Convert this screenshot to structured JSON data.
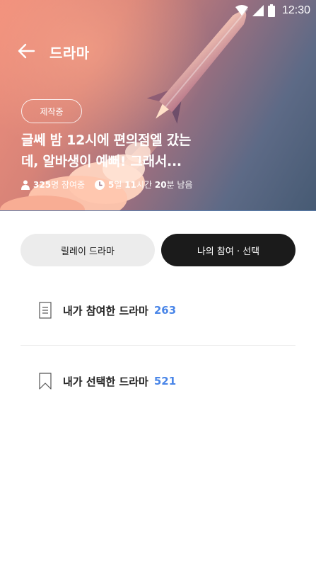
{
  "status_bar": {
    "time": "12:30",
    "icons": [
      "wifi-icon",
      "cell-signal-icon",
      "battery-icon"
    ]
  },
  "header": {
    "back_icon": "arrow-left-icon",
    "title": "드라마"
  },
  "hero": {
    "badge": "제작중",
    "title_line1": "글쎄 밤 12시에 편의점엘 갔는",
    "title_line2": "데, 알바생이 예뻐! 그래서...",
    "participants": {
      "icon": "person-icon",
      "count": "325",
      "text": "명 참여중"
    },
    "time_left": {
      "icon": "clock-icon",
      "days": "5",
      "days_unit": "일 ",
      "hours": "11",
      "hours_unit": "시간 ",
      "minutes": "20",
      "minutes_unit": "분 남음"
    }
  },
  "tabs": [
    {
      "label": "릴레이 드라마",
      "active": false
    },
    {
      "label": "나의 참여 · 선택",
      "active": true
    }
  ],
  "list": [
    {
      "icon": "document-icon",
      "label": "내가 참여한 드라마",
      "count": "263"
    },
    {
      "icon": "bookmark-icon",
      "label": "내가 선택한 드라마",
      "count": "521"
    }
  ],
  "colors": {
    "accent_blue": "#4a86e8",
    "dark_button": "#1b1b1b",
    "light_button": "#ececec",
    "hero_start": "#f2907c",
    "hero_end": "#465a73"
  }
}
